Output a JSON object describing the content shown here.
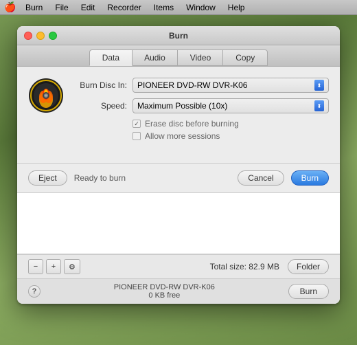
{
  "menubar": {
    "apple": "🍎",
    "items": [
      "Burn",
      "File",
      "Edit",
      "Recorder",
      "Items",
      "Window",
      "Help"
    ]
  },
  "window": {
    "title": "Burn",
    "tabs": [
      {
        "label": "Data",
        "active": true
      },
      {
        "label": "Audio",
        "active": false
      },
      {
        "label": "Video",
        "active": false
      },
      {
        "label": "Copy",
        "active": false
      }
    ],
    "form": {
      "burn_disc_label": "Burn Disc In:",
      "burn_disc_value": "PIONEER DVD-RW DVR-K06",
      "speed_label": "Speed:",
      "speed_value": "Maximum Possible (10x)",
      "erase_label": "Erase disc before burning",
      "sessions_label": "Allow more sessions"
    },
    "action_bar": {
      "eject_label": "Eject",
      "status": "Ready to burn",
      "cancel_label": "Cancel",
      "burn_label": "Burn"
    },
    "bottom_toolbar": {
      "minus": "−",
      "plus": "+",
      "gear": "⚙",
      "total_size": "Total size: 82.9 MB",
      "folder_label": "Folder"
    },
    "status_bar": {
      "help": "?",
      "disc_name": "PIONEER DVD-RW DVR-K06",
      "disc_free": "0 KB free",
      "burn_label": "Burn"
    }
  }
}
